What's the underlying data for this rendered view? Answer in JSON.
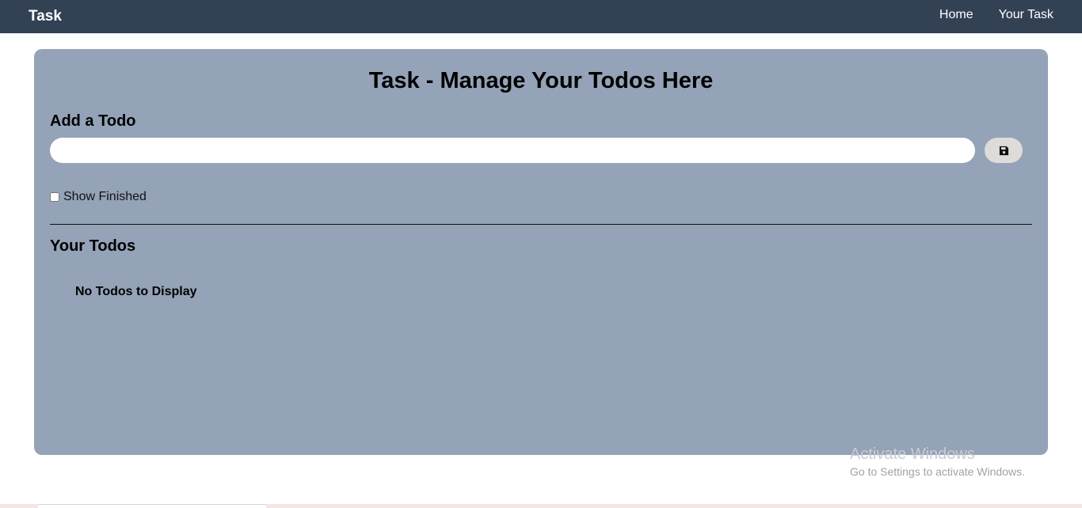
{
  "nav": {
    "brand": "Task",
    "links": [
      "Home",
      "Your Task"
    ]
  },
  "main": {
    "title": "Task - Manage Your Todos Here",
    "add_heading": "Add a Todo",
    "input_value": "",
    "save_icon": "save-icon",
    "show_finished_label": "Show Finished",
    "show_finished_checked": false,
    "todos_heading": "Your Todos",
    "empty_message": "No Todos to Display"
  },
  "watermark": {
    "title": "Activate Windows",
    "subtitle": "Go to Settings to activate Windows."
  },
  "colors": {
    "navbar": "#334155",
    "card": "#94a3b8",
    "save_button": "#dedcd9"
  }
}
